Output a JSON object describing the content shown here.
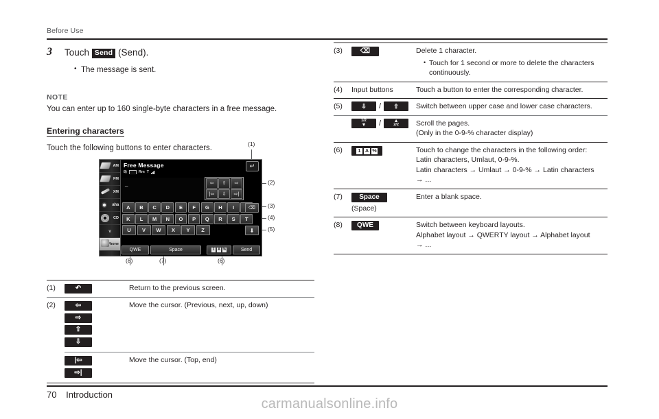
{
  "page": {
    "running_head": "Before Use",
    "folio_number": "70",
    "folio_section": "Introduction",
    "watermark": "carmanualsonline.info"
  },
  "step": {
    "number": "3",
    "text_before": "Touch",
    "button_label": "Send",
    "text_after": "(Send).",
    "bullets": [
      "The message is sent."
    ]
  },
  "note": {
    "heading": "NOTE",
    "body": "You can enter up to 160 single-byte characters in a free message."
  },
  "section": {
    "heading": "Entering characters",
    "body": "Touch the following buttons to enter characters."
  },
  "figure": {
    "callouts": [
      "(1)",
      "(2)",
      "(3)",
      "(4)",
      "(5)",
      "(6)",
      "(7)",
      "(8)"
    ],
    "device": {
      "title": "Free Message",
      "status": {
        "bt": "8)",
        "battery": "███",
        "roaming": "Rm",
        "signal": "T"
      },
      "text_value": "_",
      "return_icon": "return-arrow",
      "sources": [
        {
          "label": "AM",
          "icon": "tape-icon"
        },
        {
          "label": "FM",
          "icon": "tape-icon"
        },
        {
          "label": "XM",
          "icon": "wand-icon"
        },
        {
          "label": "aha",
          "icon": "aha-icon"
        },
        {
          "label": "CD",
          "icon": "disc-icon"
        },
        {
          "label": "∨",
          "icon": "chevron-down-icon"
        },
        {
          "label": "Phone",
          "icon": "phone-icon"
        }
      ],
      "cursor_keys": [
        "⇦",
        "⇧",
        "⇨",
        "|⇦",
        "⇩",
        "⇨|"
      ],
      "keyboard_rows": [
        [
          "A",
          "B",
          "C",
          "D",
          "E",
          "F",
          "G",
          "H",
          "I",
          "J"
        ],
        [
          "K",
          "L",
          "M",
          "N",
          "O",
          "P",
          "Q",
          "R",
          "S",
          "T"
        ],
        [
          "U",
          "V",
          "W",
          "X",
          "Y",
          "Z"
        ]
      ],
      "delete_icon": "backspace-icon",
      "down_icon": "down-arrow-icon",
      "bottom_bar": {
        "qwe": "QWE",
        "space": "Space",
        "mode_boxes": [
          "1",
          "A",
          "%"
        ],
        "send": "Send"
      }
    }
  },
  "table_left": {
    "rows": [
      {
        "num": "(1)",
        "buttons": [
          {
            "type": "pill",
            "glyph": "↶",
            "name": "return-button"
          }
        ],
        "desc": "Return to the previous screen.",
        "sub": []
      },
      {
        "num": "(2)",
        "buttons": [
          {
            "type": "pill",
            "glyph": "⇦",
            "name": "cursor-left-button"
          },
          {
            "type": "pill",
            "glyph": "⇨",
            "name": "cursor-right-button"
          },
          {
            "type": "pill",
            "glyph": "⇧",
            "name": "cursor-up-button"
          },
          {
            "type": "pill",
            "glyph": "⇩",
            "name": "cursor-down-button"
          }
        ],
        "desc": "Move the cursor. (Previous, next, up, down)",
        "sub": []
      },
      {
        "num": "",
        "buttons": [
          {
            "type": "pill",
            "glyph": "|⇦",
            "name": "cursor-top-button"
          },
          {
            "type": "pill",
            "glyph": "⇨|",
            "name": "cursor-end-button"
          }
        ],
        "desc": "Move the cursor. (Top, end)",
        "sub": []
      }
    ]
  },
  "table_right": {
    "rows": [
      {
        "num": "(3)",
        "desc": "Delete 1 character.",
        "sub": [
          "Touch for 1 second or more to delete the characters continuously."
        ]
      },
      {
        "num": "(4)",
        "button_text": "Input buttons",
        "desc": "Touch a button to enter the corresponding character.",
        "sub": []
      },
      {
        "num": "(5)",
        "desc": "Switch between upper case and lower case characters.",
        "sub": []
      },
      {
        "num": "",
        "desc": "Scroll the pages.",
        "desc2": "(Only in the 0-9-% character display)",
        "sub": []
      },
      {
        "num": "(6)",
        "mode_boxes": [
          "1",
          "A",
          "%"
        ],
        "desc": "Touch to change the characters in the following order:",
        "desc2": "Latin characters, Umlaut, 0-9-%.",
        "desc3": "Latin characters → Umlaut → 0-9-% → Latin characters",
        "desc4": "→ ...",
        "sub": []
      },
      {
        "num": "(7)",
        "pill_label": "Space",
        "sublabel": "(Space)",
        "desc": "Enter a blank space.",
        "sub": []
      },
      {
        "num": "(8)",
        "pill_label": "QWE",
        "desc": "Switch between keyboard layouts.",
        "desc2": "Alphabet layout → QWERTY layout → Alphabet layout",
        "desc3": "→ ...",
        "sub": []
      }
    ],
    "shift_pills": {
      "lower": "⇩",
      "upper": "⇧"
    },
    "page_pills": {
      "first": "1/2",
      "second": "2/2"
    }
  }
}
